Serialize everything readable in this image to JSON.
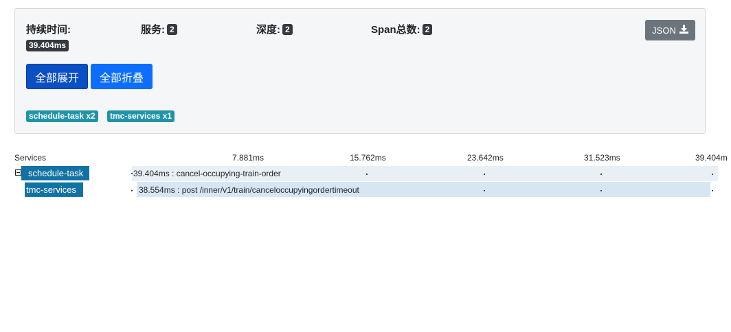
{
  "summary": {
    "duration_label": "持续时间:",
    "duration_value": "39.404ms",
    "services_label": "服务:",
    "services_count": "2",
    "depth_label": "深度:",
    "depth_count": "2",
    "span_label": "Span总数:",
    "span_count": "2",
    "json_label": "JSON",
    "json_icon": "download-icon"
  },
  "actions": {
    "expand_all": "全部展开",
    "collapse_all": "全部折叠"
  },
  "service_tags": [
    {
      "label": "schedule-task x2"
    },
    {
      "label": "tmc-services x1"
    }
  ],
  "timeline": {
    "services_header": "Services",
    "ticks": [
      "7.881ms",
      "15.762ms",
      "23.642ms",
      "31.523ms",
      "39.404m"
    ]
  },
  "spans": [
    {
      "service": "schedule-task",
      "text": "39.404ms : cancel-occupying-train-order",
      "collapsible": true
    },
    {
      "service": "tmc-services",
      "text": "38.554ms : post /inner/v1/train/canceloccupyingordertimeout",
      "collapsible": false
    }
  ],
  "colors": {
    "primary_active": "#0b4fc4",
    "primary": "#0d6efd",
    "secondary": "#6c757d",
    "dark_badge": "#343a40",
    "tag": "#1f94a8",
    "service_label": "#1372a4"
  }
}
